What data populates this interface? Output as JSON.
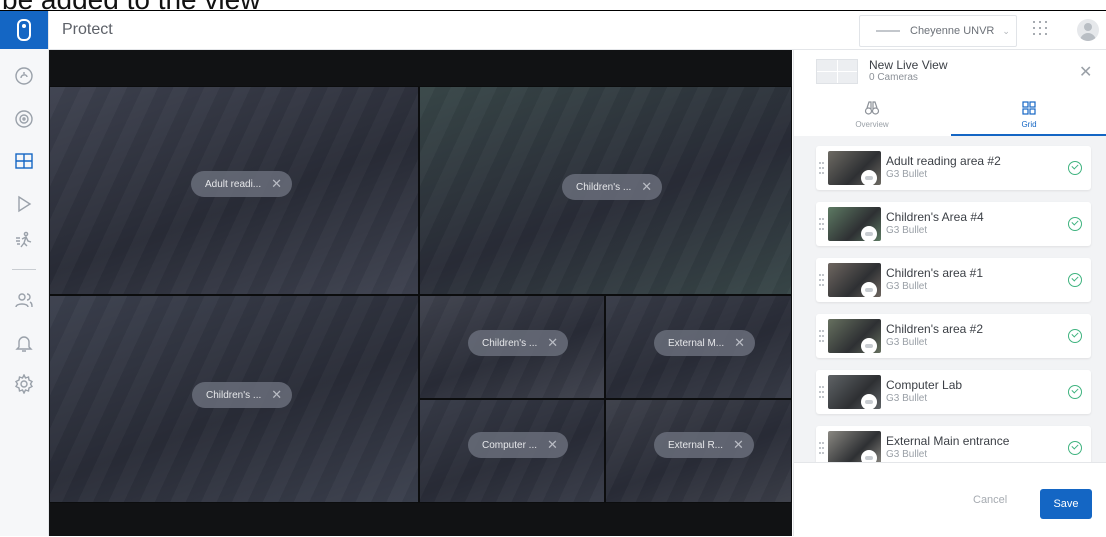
{
  "overlay": {
    "text": "be added to the view"
  },
  "app": {
    "title": "Protect",
    "console_name": "Cheyenne UNVR"
  },
  "nav": {
    "items": [
      {
        "icon": "dashboard-icon"
      },
      {
        "icon": "devices-icon"
      },
      {
        "icon": "liveview-grid-icon",
        "active": true
      },
      {
        "icon": "timeline-play-icon"
      },
      {
        "icon": "motion-icon"
      },
      {
        "icon": "users-icon"
      },
      {
        "icon": "alerts-bell-icon"
      },
      {
        "icon": "settings-gear-icon"
      }
    ]
  },
  "wall": {
    "tiles": [
      {
        "label": "Adult readi...",
        "tone": "#5a5e6a"
      },
      {
        "label": "Children's ...",
        "tone": "#4d6a5a"
      },
      {
        "label": "Children's ...",
        "tone": "#545a66"
      },
      {
        "label": "Children's ...",
        "tone": "#5d5f66"
      },
      {
        "label": "External M...",
        "tone": "#4b4f57"
      },
      {
        "label": "Computer ...",
        "tone": "#4a4e58"
      },
      {
        "label": "External R...",
        "tone": "#55575c"
      }
    ]
  },
  "panel": {
    "title": "New Live View",
    "subtitle": "0 Cameras",
    "tabs": [
      {
        "label": "Overview"
      },
      {
        "label": "Grid"
      }
    ],
    "cameras": [
      {
        "name": "Adult reading area #2",
        "model": "G3 Bullet",
        "tone": "#6d6a63"
      },
      {
        "name": "Children's Area #4",
        "model": "G3 Bullet",
        "tone": "#5d7a63"
      },
      {
        "name": "Children's area #1",
        "model": "G3 Bullet",
        "tone": "#6e6660"
      },
      {
        "name": "Children's area #2",
        "model": "G3 Bullet",
        "tone": "#66705f"
      },
      {
        "name": "Computer Lab",
        "model": "G3 Bullet",
        "tone": "#5f6366"
      },
      {
        "name": "External Main entrance",
        "model": "G3 Bullet",
        "tone": "#8a8882"
      }
    ],
    "cancel_label": "Cancel",
    "save_label": "Save"
  },
  "colors": {
    "accent": "#1466c4",
    "check": "#3fb37f",
    "wall_bg": "#111214"
  }
}
